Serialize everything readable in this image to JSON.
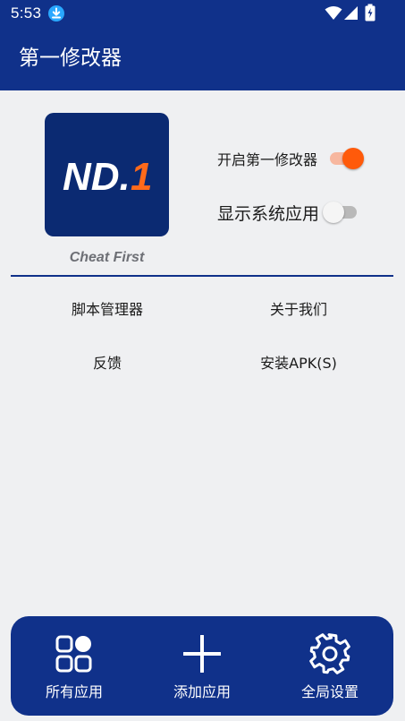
{
  "status_bar": {
    "time": "5:53",
    "icons": [
      "download-icon",
      "wifi-icon",
      "signal-icon",
      "battery-icon"
    ]
  },
  "app_bar": {
    "title": "第一修改器"
  },
  "logo": {
    "text": "ND.",
    "number": "1",
    "tagline": "Cheat First"
  },
  "switches": {
    "enable": {
      "label": "开启第一修改器",
      "on": true
    },
    "show_system_apps": {
      "label": "显示系统应用",
      "on": false
    }
  },
  "menu": {
    "script_manager": "脚本管理器",
    "about_us": "关于我们",
    "feedback": "反馈",
    "install_apk": "安装APK(S)"
  },
  "bottom_nav": {
    "all_apps": {
      "label": "所有应用",
      "icon": "apps-grid-icon"
    },
    "add_app": {
      "label": "添加应用",
      "icon": "plus-icon"
    },
    "global_settings": {
      "label": "全局设置",
      "icon": "gear-icon"
    }
  },
  "colors": {
    "primary": "#10318a",
    "accent": "#ff5a0a",
    "background": "#eff0f2",
    "logo_bg": "#0b2a72"
  }
}
